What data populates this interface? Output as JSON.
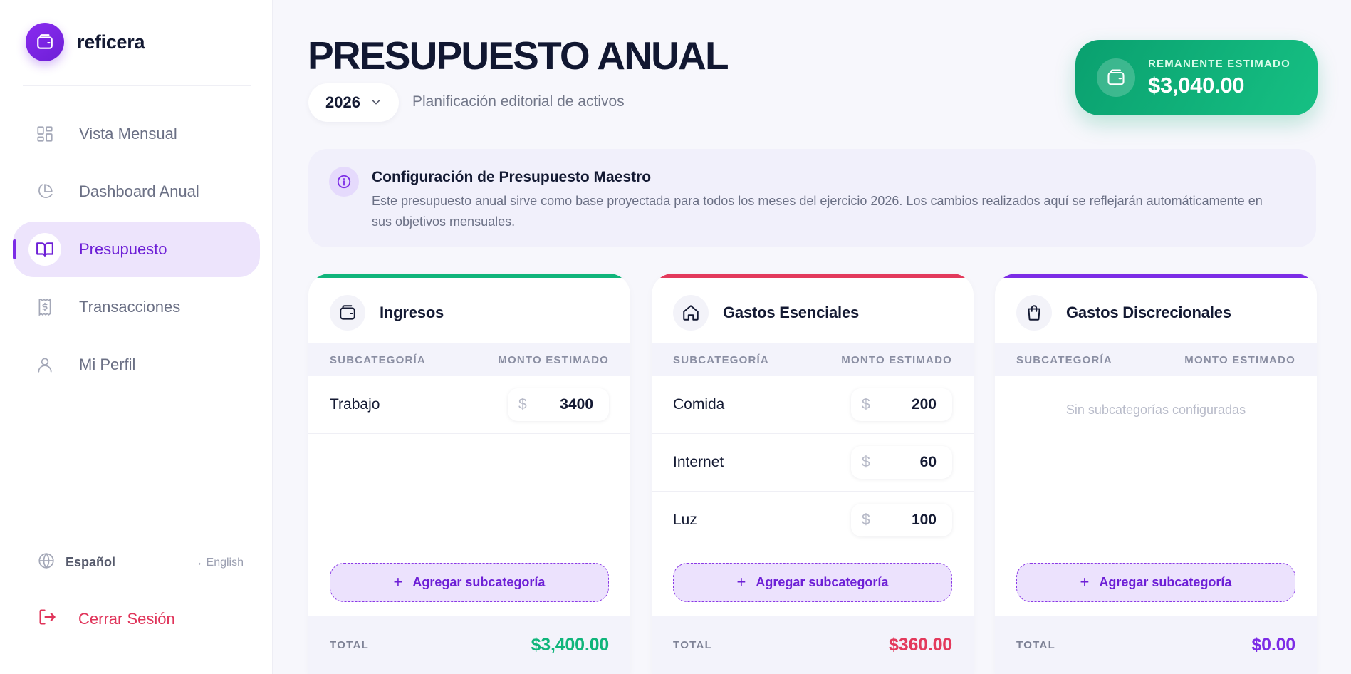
{
  "brand": {
    "name": "reficera"
  },
  "nav": [
    {
      "label": "Vista Mensual",
      "icon": "grid-icon",
      "active": false
    },
    {
      "label": "Dashboard Anual",
      "icon": "pie-chart-icon",
      "active": false
    },
    {
      "label": "Presupuesto",
      "icon": "book-icon",
      "active": true
    },
    {
      "label": "Transacciones",
      "icon": "receipt-icon",
      "active": false
    },
    {
      "label": "Mi Perfil",
      "icon": "user-icon",
      "active": false
    }
  ],
  "language": {
    "current": "Español",
    "switch": "→ English"
  },
  "logout": {
    "label": "Cerrar Sesión"
  },
  "header": {
    "title": "PRESUPUESTO ANUAL",
    "year": "2026",
    "subtitle": "Planificación editorial de activos"
  },
  "remaining": {
    "label": "REMANENTE ESTIMADO",
    "amount": "$3,040.00"
  },
  "info": {
    "title": "Configuración de Presupuesto Maestro",
    "text": "Este presupuesto anual sirve como base proyectada para todos los meses del ejercicio 2026. Los cambios realizados aquí se reflejarán automáticamente en sus objetivos mensuales."
  },
  "table_headers": {
    "subcategory": "SUBCATEGORÍA",
    "amount": "MONTO ESTIMADO"
  },
  "common": {
    "currency": "$",
    "add_label": "Agregar subcategoría",
    "total_label": "TOTAL",
    "empty_text": "Sin subcategorías configuradas"
  },
  "colors": {
    "income": "#10b57b",
    "essential": "#e33a5c",
    "discretionary": "#7c2ce6",
    "accent": "#6d1fd6"
  },
  "cards": [
    {
      "name": "Ingresos",
      "icon": "wallet-icon",
      "rows": [
        {
          "name": "Trabajo",
          "value": "3400"
        }
      ],
      "total": "$3,400.00"
    },
    {
      "name": "Gastos Esenciales",
      "icon": "home-icon",
      "rows": [
        {
          "name": "Comida",
          "value": "200"
        },
        {
          "name": "Internet",
          "value": "60"
        },
        {
          "name": "Luz",
          "value": "100"
        }
      ],
      "total": "$360.00"
    },
    {
      "name": "Gastos Discrecionales",
      "icon": "shopping-bag-icon",
      "rows": [],
      "total": "$0.00"
    }
  ]
}
